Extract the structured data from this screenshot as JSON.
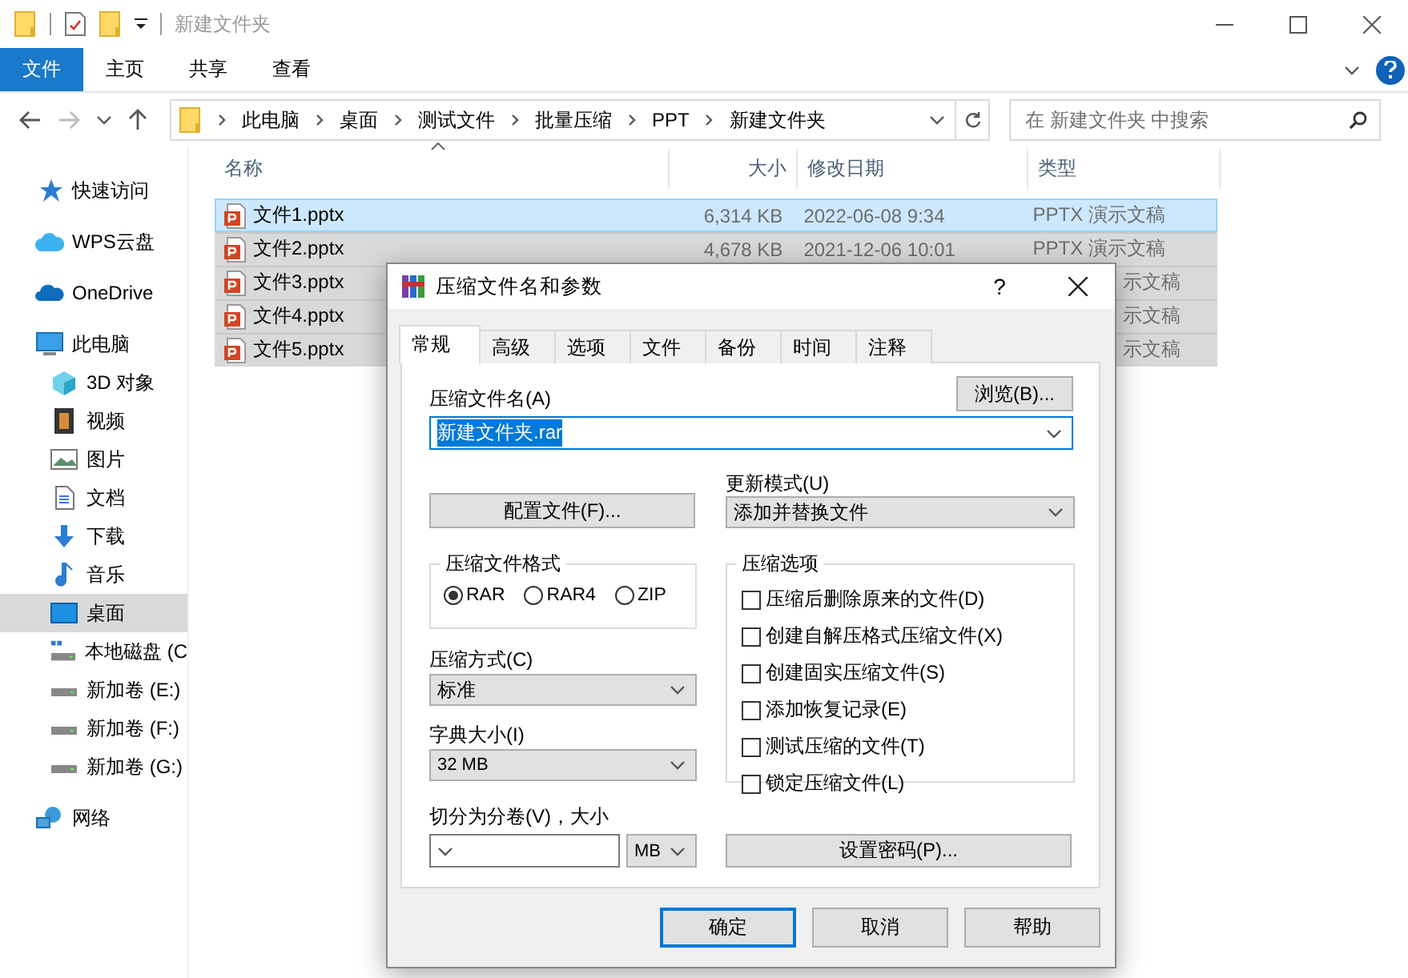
{
  "window": {
    "title": "新建文件夹"
  },
  "ribbon_tabs": [
    {
      "label": "文件",
      "selected": true
    },
    {
      "label": "主页",
      "selected": false
    },
    {
      "label": "共享",
      "selected": false
    },
    {
      "label": "查看",
      "selected": false
    }
  ],
  "address": {
    "crumbs": [
      "此电脑",
      "桌面",
      "测试文件",
      "批量压缩",
      "PPT",
      "新建文件夹"
    ]
  },
  "search": {
    "placeholder": "在 新建文件夹 中搜索"
  },
  "nav": [
    {
      "label": "快速访问",
      "kind": "star",
      "selected": false
    },
    {
      "label": "WPS云盘",
      "kind": "wps",
      "selected": false
    },
    {
      "label": "OneDrive",
      "kind": "cloud",
      "selected": false
    },
    {
      "label": "此电脑",
      "kind": "pc",
      "selected": false,
      "children": [
        {
          "label": "3D 对象",
          "kind": "cube",
          "selected": false
        },
        {
          "label": "视频",
          "kind": "film",
          "selected": false
        },
        {
          "label": "图片",
          "kind": "image",
          "selected": false
        },
        {
          "label": "文档",
          "kind": "doc",
          "selected": false
        },
        {
          "label": "下载",
          "kind": "download",
          "selected": false
        },
        {
          "label": "音乐",
          "kind": "music",
          "selected": false
        },
        {
          "label": "桌面",
          "kind": "desktop",
          "selected": true
        },
        {
          "label": "本地磁盘 (C",
          "kind": "osdrive",
          "selected": false
        },
        {
          "label": "新加卷 (E:)",
          "kind": "drive",
          "selected": false
        },
        {
          "label": "新加卷 (F:)",
          "kind": "drive",
          "selected": false
        },
        {
          "label": "新加卷 (G:)",
          "kind": "drive",
          "selected": false
        }
      ]
    },
    {
      "label": "网络",
      "kind": "network",
      "selected": false
    }
  ],
  "columns": [
    {
      "label": "名称",
      "sorted": true
    },
    {
      "label": "大小",
      "sorted": false
    },
    {
      "label": "修改日期",
      "sorted": false
    },
    {
      "label": "类型",
      "sorted": false
    }
  ],
  "files": [
    {
      "name": "文件1.pptx",
      "size": "6,314 KB",
      "modified": "2022-06-08 9:34",
      "type": "PPTX 演示文稿",
      "selected": true,
      "focused": true
    },
    {
      "name": "文件2.pptx",
      "size": "4,678 KB",
      "modified": "2021-12-06 10:01",
      "type": "PPTX 演示文稿",
      "selected": true,
      "focused": false
    },
    {
      "name": "文件3.pptx",
      "type": "示文稿",
      "selected": true,
      "focused": false
    },
    {
      "name": "文件4.pptx",
      "type": "示文稿",
      "selected": true,
      "focused": false
    },
    {
      "name": "文件5.pptx",
      "type": "示文稿",
      "selected": true,
      "focused": false
    }
  ],
  "dialog": {
    "title": "压缩文件名和参数",
    "help": "?",
    "tabs": [
      {
        "label": "常规",
        "selected": true
      },
      {
        "label": "高级",
        "selected": false
      },
      {
        "label": "选项",
        "selected": false
      },
      {
        "label": "文件",
        "selected": false
      },
      {
        "label": "备份",
        "selected": false
      },
      {
        "label": "时间",
        "selected": false
      },
      {
        "label": "注释",
        "selected": false
      }
    ],
    "archive_name": {
      "label": "压缩文件名(A)",
      "value": "新建文件夹.rar",
      "highlighted": true
    },
    "browse_button": "浏览(B)...",
    "profiles_button": "配置文件(F)...",
    "update_mode": {
      "label": "更新模式(U)",
      "value": "添加并替换文件"
    },
    "format": {
      "label": "压缩文件格式",
      "options": [
        {
          "label": "RAR",
          "selected": true
        },
        {
          "label": "RAR4",
          "selected": false
        },
        {
          "label": "ZIP",
          "selected": false
        }
      ]
    },
    "method": {
      "label": "压缩方式(C)",
      "value": "标准"
    },
    "dictionary": {
      "label": "字典大小(I)",
      "value": "32 MB"
    },
    "split": {
      "label": "切分为分卷(V)，大小",
      "unit": "MB"
    },
    "options": {
      "label": "压缩选项",
      "items": [
        {
          "label": "压缩后删除原来的文件(D)",
          "checked": false
        },
        {
          "label": "创建自解压格式压缩文件(X)",
          "checked": false
        },
        {
          "label": "创建固实压缩文件(S)",
          "checked": false
        },
        {
          "label": "添加恢复记录(E)",
          "checked": false
        },
        {
          "label": "测试压缩的文件(T)",
          "checked": false
        },
        {
          "label": "锁定压缩文件(L)",
          "checked": false
        }
      ]
    },
    "password_button": "设置密码(P)...",
    "buttons": [
      {
        "label": "确定",
        "default": true
      },
      {
        "label": "取消",
        "default": false
      },
      {
        "label": "帮助",
        "default": false
      }
    ]
  }
}
